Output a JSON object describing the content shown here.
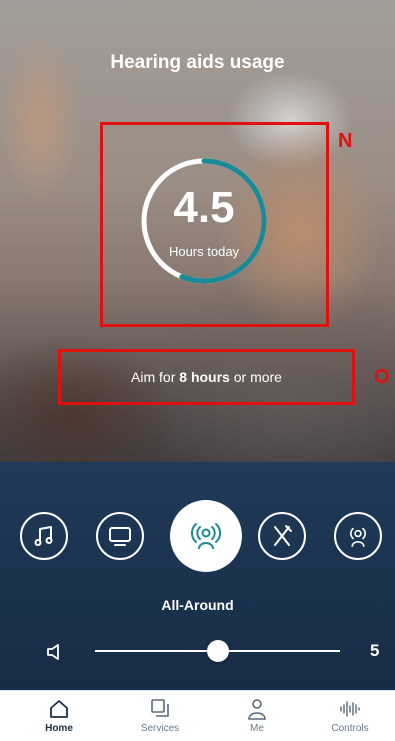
{
  "screen": {
    "title": "Hearing aids usage",
    "usage": {
      "hours_value": "4.5",
      "hours_label": "Hours today",
      "progress_fraction": 0.56,
      "aim_prefix": "Aim for ",
      "aim_bold": "8 hours",
      "aim_suffix": " or more"
    }
  },
  "annotations": [
    "N",
    "O"
  ],
  "programs": {
    "items": [
      {
        "name": "music",
        "icon": "music-note-icon"
      },
      {
        "name": "tv",
        "icon": "tv-icon"
      },
      {
        "name": "all-around",
        "icon": "hearing-person-icon",
        "active": true
      },
      {
        "name": "restaurant",
        "icon": "fork-knife-icon"
      },
      {
        "name": "speech",
        "icon": "hearing-person-icon"
      }
    ],
    "current_label": "All-Around"
  },
  "volume": {
    "value": "5",
    "level_fraction": 0.5
  },
  "tabs": [
    {
      "label": "Home",
      "icon": "home-icon",
      "active": true
    },
    {
      "label": "Services",
      "icon": "services-icon"
    },
    {
      "label": "Me",
      "icon": "person-icon"
    },
    {
      "label": "Controls",
      "icon": "equalizer-icon"
    }
  ],
  "colors": {
    "accent": "#1a8a96",
    "panel": "#1b3350",
    "annotation": "#e01010"
  }
}
